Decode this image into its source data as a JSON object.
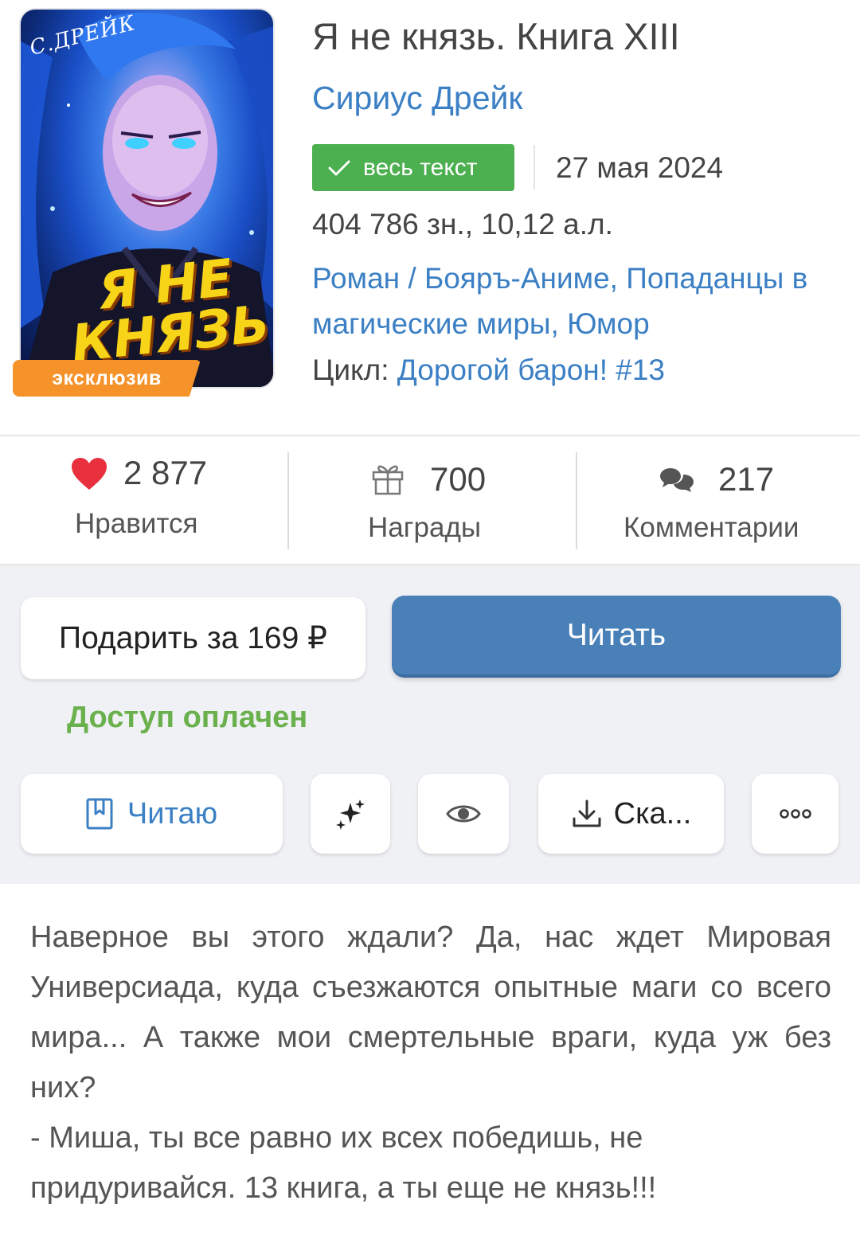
{
  "book": {
    "cover": {
      "author_lettering": "С.ДРЕЙК",
      "title_lettering": "Я НЕ КНЯЗЬ",
      "badge": "эксклюзив"
    },
    "title": "Я не князь. Книга XIII",
    "author": "Сириус Дрейк",
    "status_badge": "весь текст",
    "date": "27 мая 2024",
    "size": "404 786 зн., 10,12 а.л.",
    "genres": [
      {
        "label": "Роман"
      },
      {
        "label": "Бояръ-Аниме"
      },
      {
        "label": "Попаданцы в магические миры"
      },
      {
        "label": "Юмор"
      }
    ],
    "cycle_prefix": "Цикл:",
    "cycle_name": "Дорогой барон!",
    "cycle_number": "#13"
  },
  "stats": {
    "likes": {
      "value": "2 877",
      "label": "Нравится",
      "icon": "heart-icon"
    },
    "awards": {
      "value": "700",
      "label": "Награды",
      "icon": "gift-icon"
    },
    "comments": {
      "value": "217",
      "label": "Комментарии",
      "icon": "comments-icon"
    }
  },
  "actions": {
    "gift_label": "Подарить за 169 ₽",
    "read_label": "Читать",
    "access_status": "Доступ оплачен",
    "reading_label": "Читаю",
    "download_label": "Ска...",
    "colors": {
      "primary": "#4a80b8",
      "success": "#4caf50",
      "access": "#6ab04c",
      "link": "#3b7fc4",
      "exclusive": "#f5922a"
    }
  },
  "description": {
    "paragraphs": [
      "Наверное вы этого ждали? Да, нас ждет Мировая Универсиада, куда съезжаются опытные маги со всего мира... А также мои смертельные враги, куда уж без них?",
      "- Миша, ты все равно их всех победишь, не придуривайся. 13 книга, а ты еще не князь!!!"
    ]
  }
}
